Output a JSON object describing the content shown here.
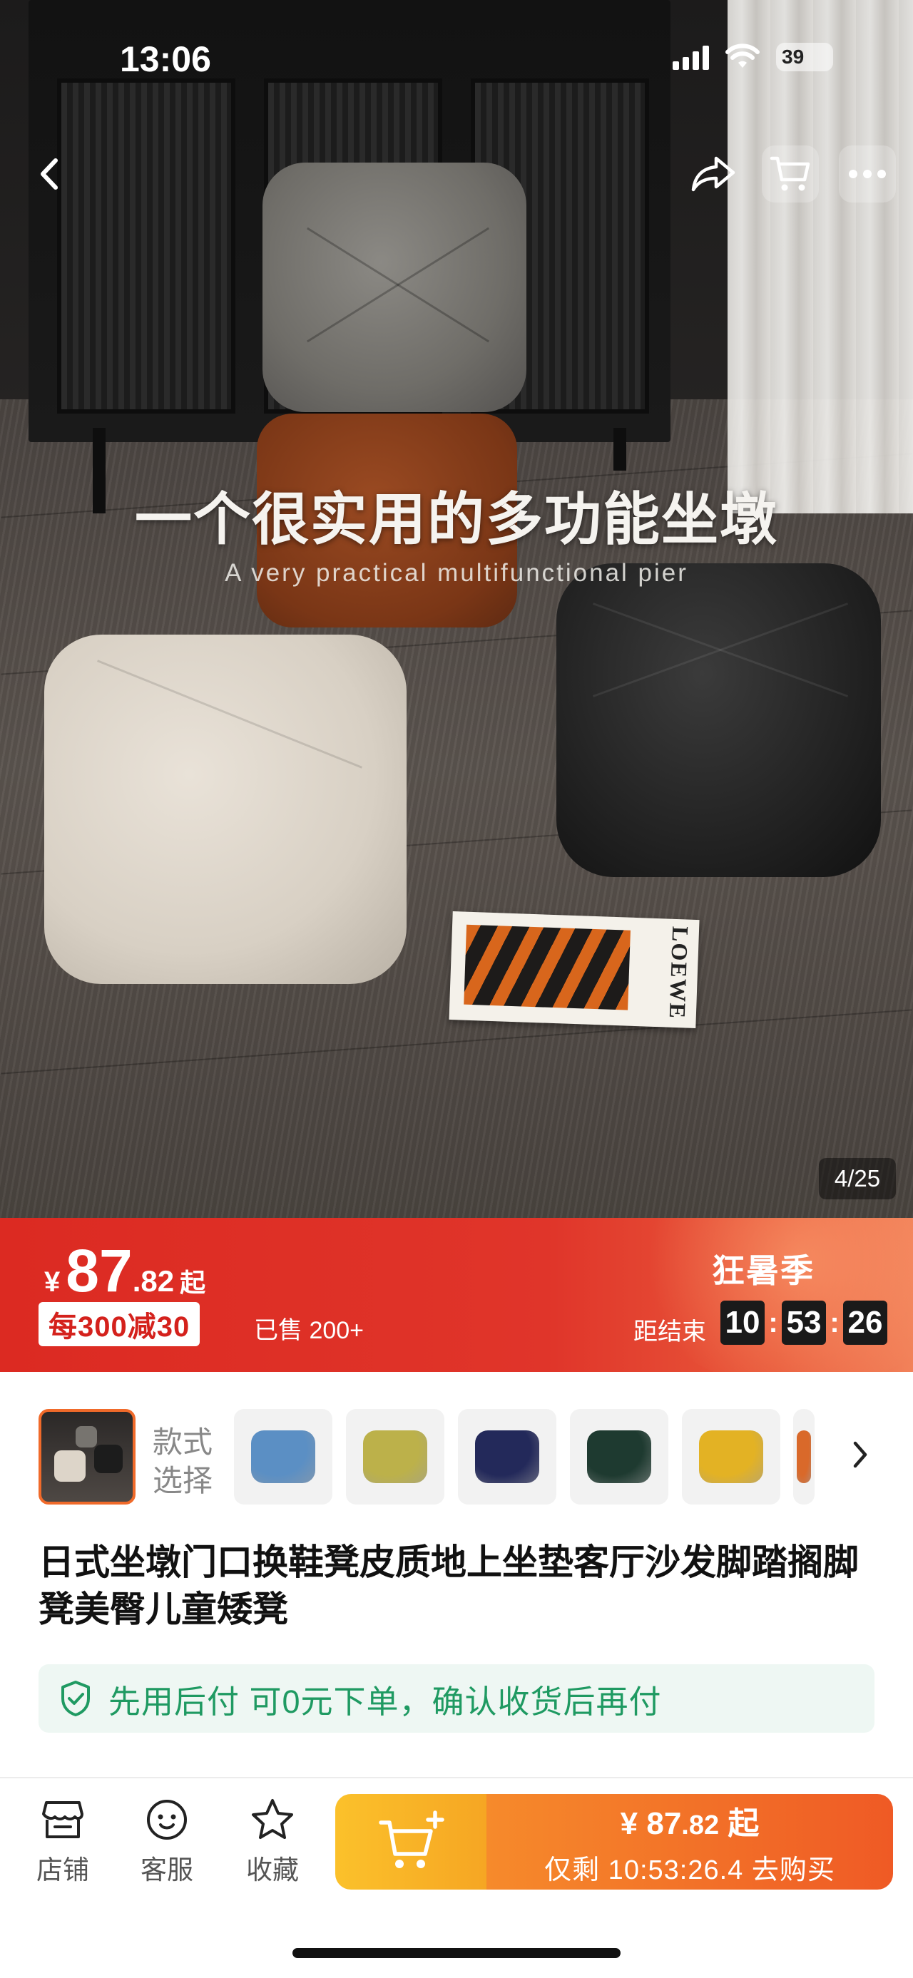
{
  "status_bar": {
    "time": "13:06",
    "battery": "39"
  },
  "hero": {
    "headline": "一个很实用的多功能坐墩",
    "subheadline": "A very practical multifunctional pier",
    "magazine_brand": "LOEWE",
    "image_counter": "4/25"
  },
  "nav": {
    "back_icon": "chevron-left-icon",
    "share_icon": "share-icon",
    "cart_icon": "cart-icon",
    "more_icon": "more-icon"
  },
  "promo": {
    "currency": "¥",
    "price_int": "87",
    "price_dec": ".82",
    "price_suffix": "起",
    "coupon": "每300减30",
    "sold": "已售 200+",
    "season": "狂暑季",
    "ends_label": "距结束",
    "countdown": {
      "h": "10",
      "m": "53",
      "s": "26"
    },
    "colors": {
      "primary": "#dc2a22",
      "accent": "#f2825a"
    }
  },
  "styles": {
    "label": "款式选择",
    "swatches": [
      {
        "name": "blue",
        "color": "#5b8fc4"
      },
      {
        "name": "olive",
        "color": "#bcb14a"
      },
      {
        "name": "navy",
        "color": "#23295a"
      },
      {
        "name": "dark-green",
        "color": "#1e3a30"
      },
      {
        "name": "mustard",
        "color": "#e3b224"
      },
      {
        "name": "orange",
        "color": "#d9692a"
      }
    ]
  },
  "product": {
    "title": "日式坐墩门口换鞋凳皮质地上坐垫客厅沙发脚踏搁脚凳美臀儿童矮凳"
  },
  "paylater": {
    "text": "先用后付 可0元下单，确认收货后再付",
    "color": "#1f9a62"
  },
  "bottom_bar": {
    "tabs": [
      {
        "label": "店铺",
        "icon": "store-icon"
      },
      {
        "label": "客服",
        "icon": "customer-service-icon"
      },
      {
        "label": "收藏",
        "icon": "star-icon"
      }
    ],
    "buy_price_prefix": "¥ ",
    "buy_price_int": "87",
    "buy_price_dec": ".82",
    "buy_price_suffix": " 起",
    "buy_sub": "仅剩 10:53:26.4 去购买"
  }
}
